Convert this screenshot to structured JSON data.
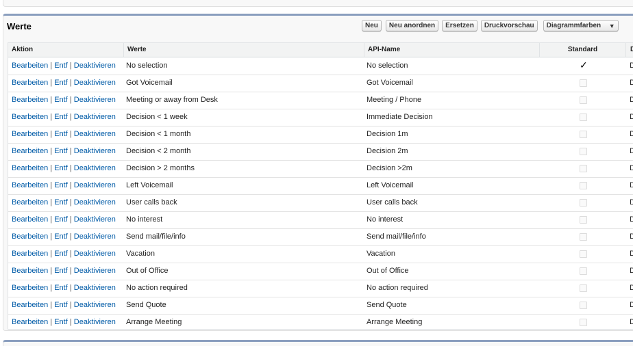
{
  "panel": {
    "title": "Werte",
    "buttons": {
      "neu": "Neu",
      "anordnen": "Neu anordnen",
      "ersetzen": "Ersetzen",
      "druck": "Druckvorschau",
      "diagramm": "Diagrammfarben"
    },
    "arrow_icon": "▼"
  },
  "table": {
    "headers": {
      "aktion": "Aktion",
      "werte": "Werte",
      "api": "API-Name",
      "standard": "Standard",
      "last": "D"
    },
    "actions": {
      "edit": "Bearbeiten",
      "del": "Entf",
      "deact": "Deaktivieren",
      "sep": "|"
    },
    "check_icon": "✓",
    "rows": [
      {
        "wert": "No selection",
        "api": "No selection",
        "standard": true,
        "last": "D"
      },
      {
        "wert": "Got Voicemail",
        "api": "Got Voicemail",
        "standard": false,
        "last": "D"
      },
      {
        "wert": "Meeting or away from Desk",
        "api": "Meeting / Phone",
        "standard": false,
        "last": "D"
      },
      {
        "wert": "Decision < 1 week",
        "api": "Immediate Decision",
        "standard": false,
        "last": "D"
      },
      {
        "wert": "Decision < 1 month",
        "api": "Decision 1m",
        "standard": false,
        "last": "D"
      },
      {
        "wert": "Decision < 2 month",
        "api": "Decision 2m",
        "standard": false,
        "last": "D"
      },
      {
        "wert": "Decision > 2 months",
        "api": "Decision >2m",
        "standard": false,
        "last": "D"
      },
      {
        "wert": "Left Voicemail",
        "api": "Left Voicemail",
        "standard": false,
        "last": "D"
      },
      {
        "wert": "User calls back",
        "api": "User calls back",
        "standard": false,
        "last": "D"
      },
      {
        "wert": "No interest",
        "api": "No interest",
        "standard": false,
        "last": "D"
      },
      {
        "wert": "Send mail/file/info",
        "api": "Send mail/file/info",
        "standard": false,
        "last": "D"
      },
      {
        "wert": "Vacation",
        "api": "Vacation",
        "standard": false,
        "last": "D"
      },
      {
        "wert": "Out of Office",
        "api": "Out of Office",
        "standard": false,
        "last": "D"
      },
      {
        "wert": "No action required",
        "api": "No action required",
        "standard": false,
        "last": "D"
      },
      {
        "wert": "Send Quote",
        "api": "Send Quote",
        "standard": false,
        "last": "D"
      },
      {
        "wert": "Arrange Meeting",
        "api": "Arrange Meeting",
        "standard": false,
        "last": "D"
      }
    ]
  }
}
